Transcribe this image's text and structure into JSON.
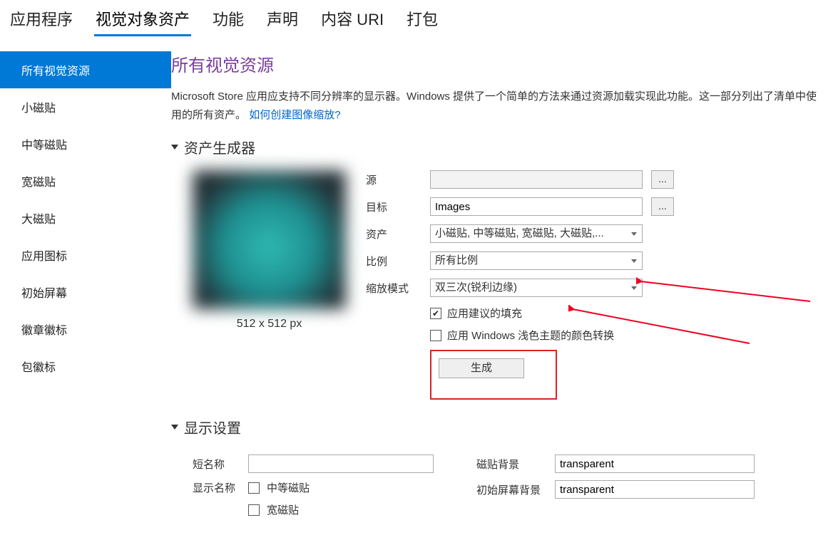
{
  "tabs": {
    "app": "应用程序",
    "visual": "视觉对象资产",
    "features": "功能",
    "declarations": "声明",
    "content_uri": "内容 URI",
    "packaging": "打包"
  },
  "sidebar": {
    "all": "所有视觉资源",
    "small": "小磁贴",
    "medium": "中等磁贴",
    "wide": "宽磁贴",
    "large": "大磁贴",
    "appicon": "应用图标",
    "splash": "初始屏幕",
    "badge": "徽章徽标",
    "package": "包徽标"
  },
  "section": {
    "title": "所有视觉资源",
    "desc1": "Microsoft Store 应用应支持不同分辨率的显示器。Windows 提供了一个简单的方法来通过资源加载实现此功能。这一部分列出了清单中使用的所有资产。",
    "link": "如何创建图像缩放?"
  },
  "assetgen": {
    "header": "资产生成器",
    "preview_caption": "512 x 512 px",
    "labels": {
      "source": "源",
      "target": "目标",
      "assets": "资产",
      "scale": "比例",
      "mode": "缩放模式"
    },
    "values": {
      "source": "",
      "target": "Images",
      "assets": "小磁贴, 中等磁贴, 宽磁贴, 大磁贴,...",
      "scale": "所有比例",
      "mode": "双三次(锐利边缘)"
    },
    "browse": "...",
    "chk_padding": "应用建议的填充",
    "chk_light": "应用 Windows 浅色主题的颜色转换",
    "generate": "生成"
  },
  "display": {
    "header": "显示设置",
    "short_name": "短名称",
    "short_name_val": "",
    "show_name": "显示名称",
    "show_medium": "中等磁贴",
    "show_wide": "宽磁贴",
    "tile_bg": "磁贴背景",
    "tile_bg_val": "transparent",
    "splash_bg": "初始屏幕背景",
    "splash_bg_val": "transparent"
  }
}
